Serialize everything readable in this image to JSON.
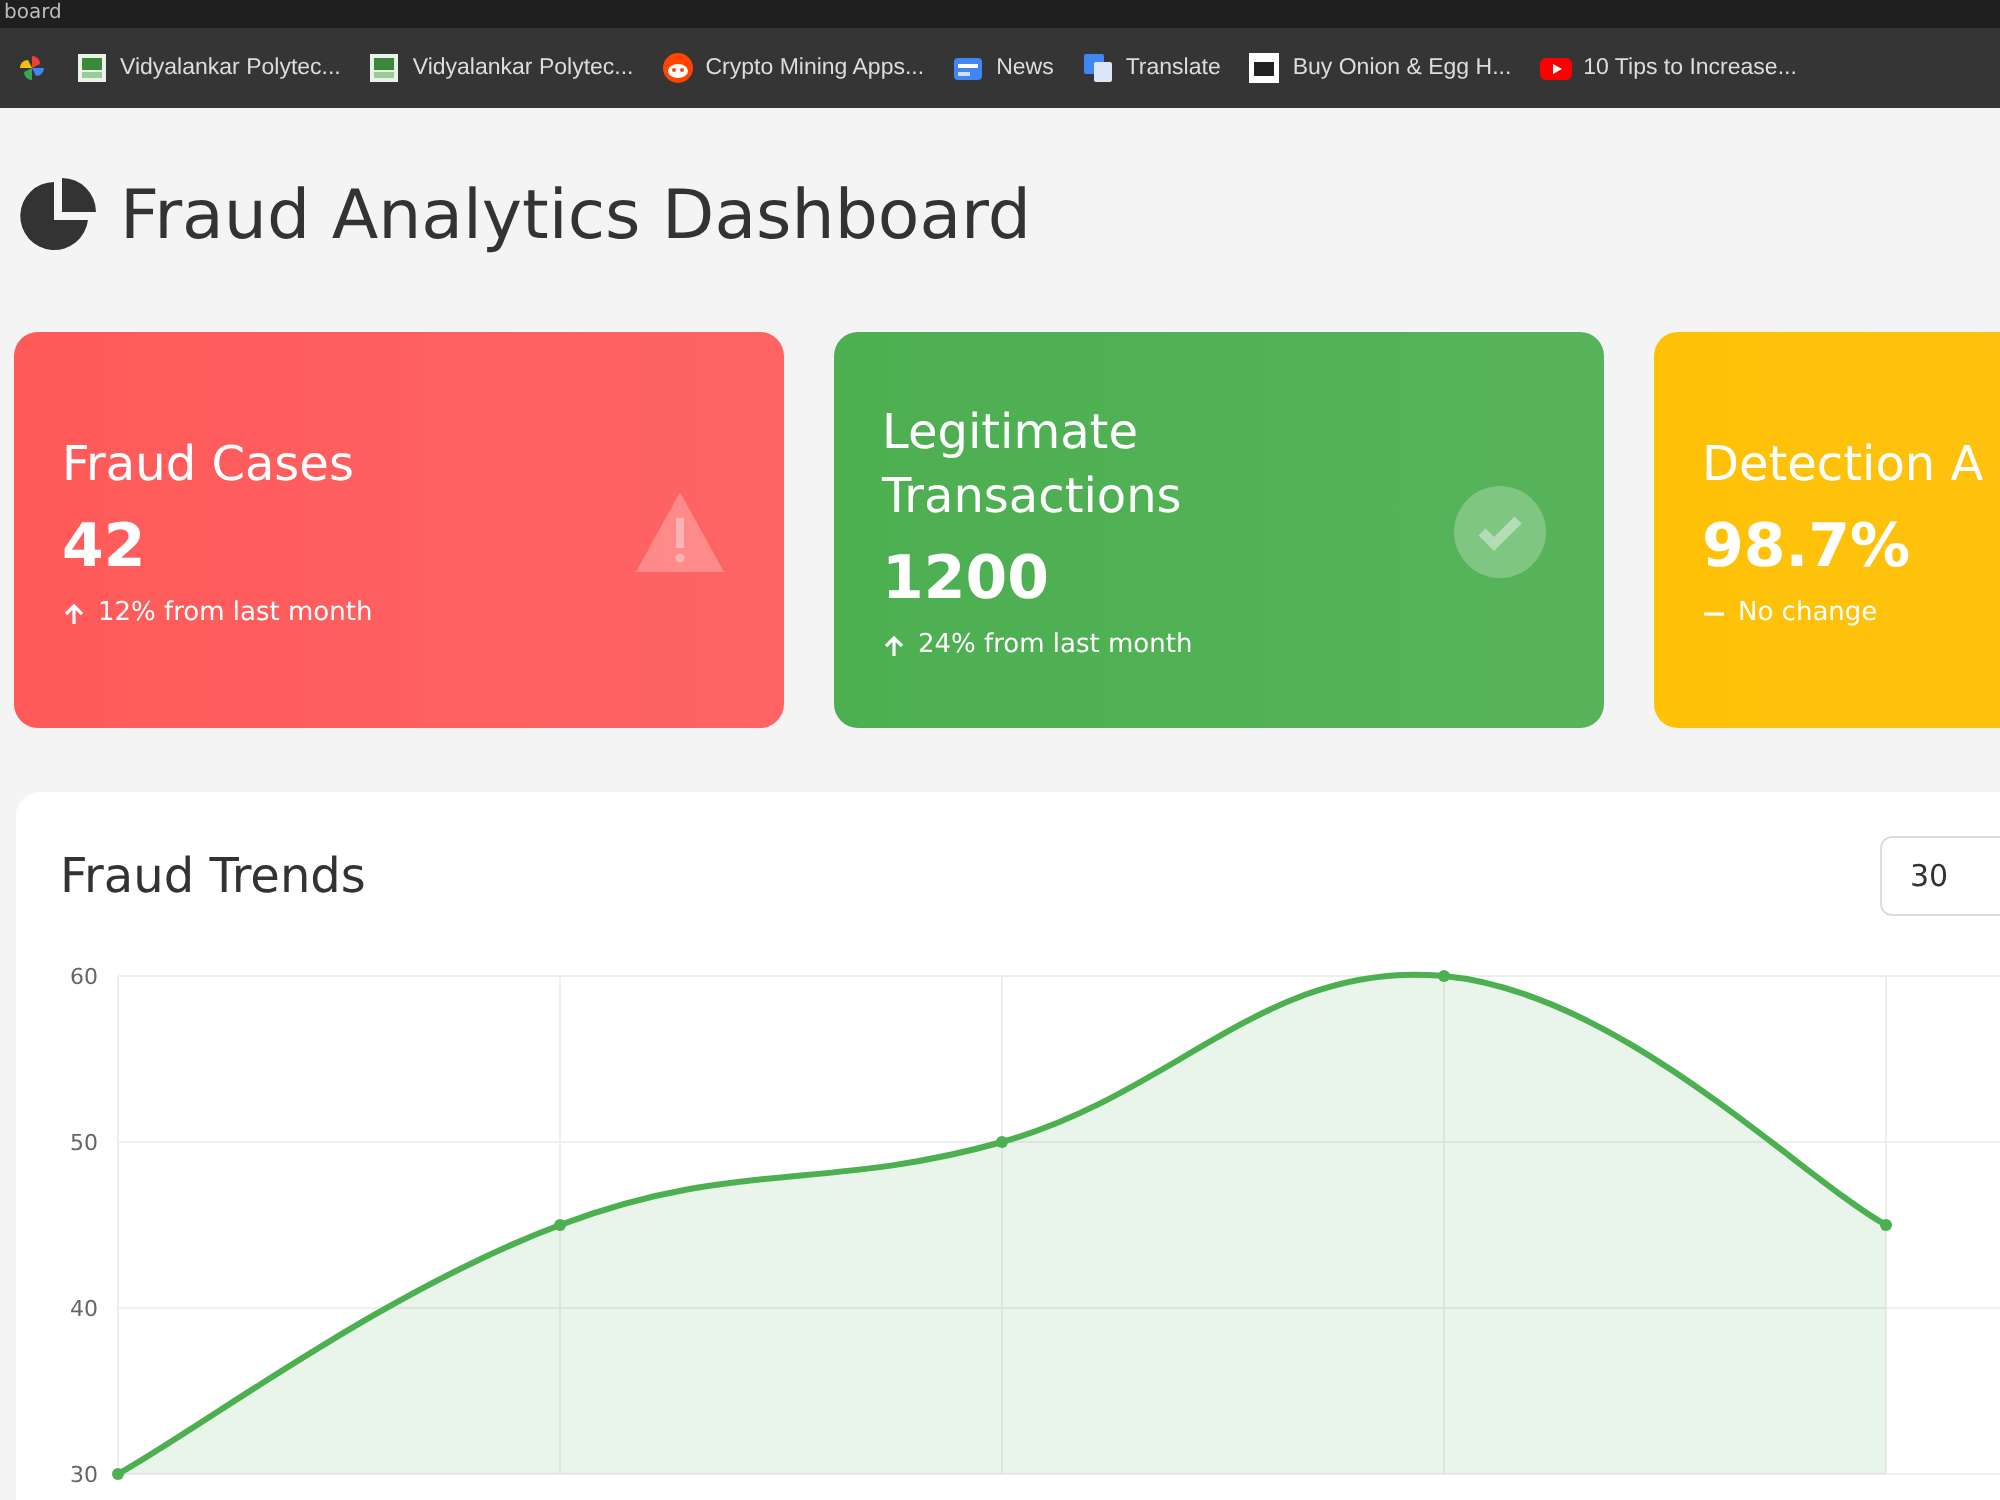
{
  "window": {
    "title": "board"
  },
  "bookmarks": [
    {
      "kind": "photos"
    },
    {
      "label": "Vidyalankar Polytec...",
      "kind": "vp"
    },
    {
      "label": "Vidyalankar Polytec...",
      "kind": "vp"
    },
    {
      "label": "Crypto Mining Apps...",
      "kind": "reddit"
    },
    {
      "label": "News",
      "kind": "news"
    },
    {
      "label": "Translate",
      "kind": "translate"
    },
    {
      "label": "Buy Onion & Egg H...",
      "kind": "store"
    },
    {
      "label": "10 Tips to Increase...",
      "kind": "youtube"
    }
  ],
  "header": {
    "title": "Fraud Analytics Dashboard"
  },
  "stats": [
    {
      "kind": "warning",
      "title": "Fraud Cases",
      "value": "42",
      "trend": {
        "kind": "up",
        "text": "12% from last month"
      },
      "color": "#ff5a5a"
    },
    {
      "kind": "check",
      "title": "Legitimate Transactions",
      "value": "1200",
      "trend": {
        "kind": "up",
        "text": "24% from last month"
      },
      "color": "#4caf50"
    },
    {
      "kind": "plain",
      "title": "Detection A",
      "value": "98.7%",
      "trend": {
        "kind": "flat",
        "text": "No change"
      },
      "color": "#ffc107"
    }
  ],
  "trends": {
    "title": "Fraud Trends",
    "range_select": "30",
    "chart_data": {
      "type": "area",
      "grid": true,
      "yticks": [
        30,
        40,
        50,
        60
      ],
      "ylim": [
        30,
        60
      ],
      "series": [
        {
          "color": "#4caf50",
          "values": [
            30,
            45,
            50,
            60,
            45
          ]
        }
      ]
    }
  }
}
